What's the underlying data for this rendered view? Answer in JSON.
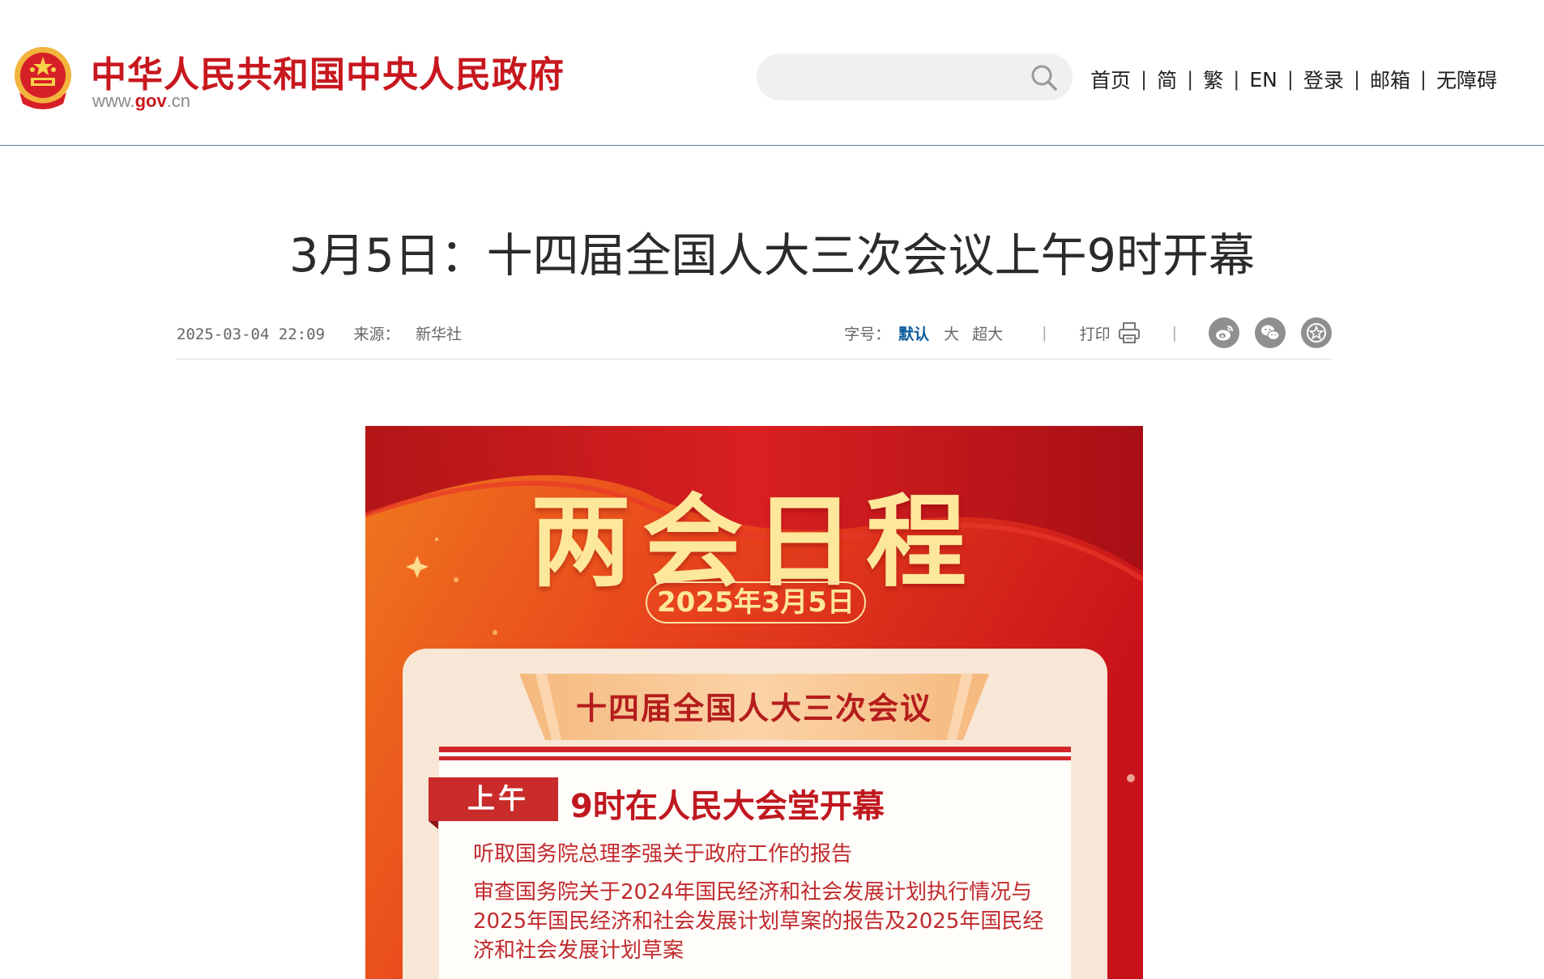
{
  "header": {
    "site_title": "中华人民共和国中央人民政府",
    "site_url_prefix": "www.",
    "site_url_gov": "gov",
    "site_url_suffix": ".cn",
    "search_placeholder": "",
    "nav": [
      "首页",
      "简",
      "繁",
      "EN",
      "登录",
      "邮箱",
      "无障碍"
    ],
    "nav_separator": "|"
  },
  "article": {
    "title": "3月5日：十四届全国人大三次会议上午9时开幕",
    "date": "2025-03-04 22:09",
    "source_label": "来源：",
    "source": "新华社",
    "font_size_label": "字号：",
    "font_sizes": [
      "默认",
      "大",
      "超大"
    ],
    "divider": "|",
    "print_label": "打印",
    "share_icons": [
      "weibo-icon",
      "wechat-icon",
      "favorite-icon"
    ]
  },
  "poster": {
    "heading": "两会日程",
    "date": "2025年3月5日",
    "meeting": "十四届全国人大三次会议",
    "tag": "上午",
    "session_title": "9时在人民大会堂开幕",
    "item1": "听取国务院总理李强关于政府工作的报告",
    "item2": "审查国务院关于2024年国民经济和社会发展计划执行情况与2025年国民经济和社会发展计划草案的报告及2025年国民经济和社会发展计划草案"
  },
  "colors": {
    "brand_red": "#c8171e",
    "active_blue": "#0b5a9e",
    "poster_gold": "#fde79a",
    "header_rule": "#5c7f93"
  }
}
